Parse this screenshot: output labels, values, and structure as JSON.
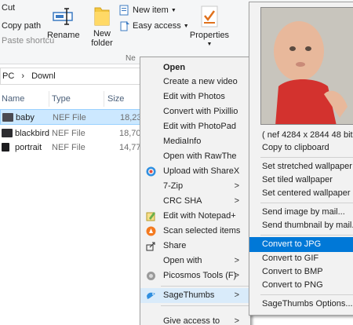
{
  "clipboard": {
    "cut": "Cut",
    "copy_path": "Copy path",
    "paste_shortcut": "Paste shortcu"
  },
  "ribbon": {
    "rename": "Rename",
    "new_folder_line1": "New",
    "new_folder_line2": "folder",
    "new_item": "New item",
    "easy_access": "Easy access",
    "properties": "Properties",
    "new_group_label": "Ne"
  },
  "address": {
    "pc": "PC",
    "sep": "›",
    "folder": "Downl"
  },
  "columns": {
    "name": "Name",
    "type": "Type",
    "size": "Size"
  },
  "files": [
    {
      "name": "baby",
      "type": "NEF File",
      "size": "18,23"
    },
    {
      "name": "blackbird",
      "type": "NEF File",
      "size": "18,70"
    },
    {
      "name": "portrait",
      "type": "NEF File",
      "size": "14,77"
    }
  ],
  "menu": {
    "items": [
      "Open",
      "Create a new video",
      "Edit with Photos",
      "Convert with Pixillio",
      "Edit with PhotoPad",
      "MediaInfo",
      "Open with RawThe",
      "Upload with ShareX",
      "7-Zip",
      "CRC SHA",
      "Edit with Notepad+",
      "Scan selected items",
      "Share",
      "Open with",
      "Picosmos Tools (F)",
      "SageThumbs",
      "Give access to"
    ]
  },
  "submenu": {
    "info": "( nef 4284 x 2844 48 bit )",
    "items": [
      "Copy to clipboard",
      "Set stretched wallpaper",
      "Set tiled wallpaper",
      "Set centered wallpaper",
      "Send image by mail...",
      "Send thumbnail by mail...",
      "Convert to JPG",
      "Convert to GIF",
      "Convert to BMP",
      "Convert to PNG",
      "SageThumbs Options..."
    ]
  },
  "colors": {
    "accent": "#0078d7",
    "selection": "#cce8ff",
    "menu_bg": "#f2f2f2"
  }
}
